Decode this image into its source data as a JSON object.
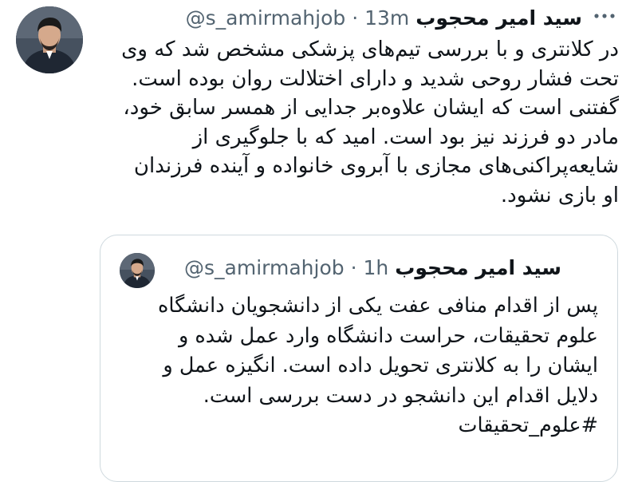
{
  "tweet": {
    "author_name": "سید امیر محجوب",
    "handle": "@s_amirmahjob",
    "separator": "·",
    "time": "13m",
    "more_icon": "more-horizontal-icon",
    "lines": [
      "در کلانتری و با بررسی تیم‌های پزشکی مشخص شد که وی",
      "تحت فشار روحی شدید و دارای اختلالت روان بوده است.",
      "گفتنی است که ایشان علاوه‌بر جدایی از همسر سابق خود،",
      "مادر دو فرزند نیز بود است. امید که با جلوگیری از",
      "شایعه‌پراکنی‌های مجازی با آبروی خانواده و آینده فرزندان",
      "او بازی نشود."
    ]
  },
  "quoted_tweet": {
    "author_name": "سید امیر محجوب",
    "handle": "@s_amirmahjob",
    "separator": "·",
    "time": "1h",
    "lines": [
      "پس از اقدام منافی عفت یکی از دانشجویان دانشگاه",
      "علوم تحقیقات، حراست دانشگاه وارد عمل شده و",
      "ایشان را به کلانتری تحویل داده است. انگیزه عمل و",
      "دلایل اقدام این دانشجو در دست بررسی است."
    ],
    "hashtag": "#علوم_تحقیقات"
  },
  "colors": {
    "text": "#0f1419",
    "secondary": "#536471",
    "border": "#cfd9de",
    "background": "#ffffff"
  }
}
